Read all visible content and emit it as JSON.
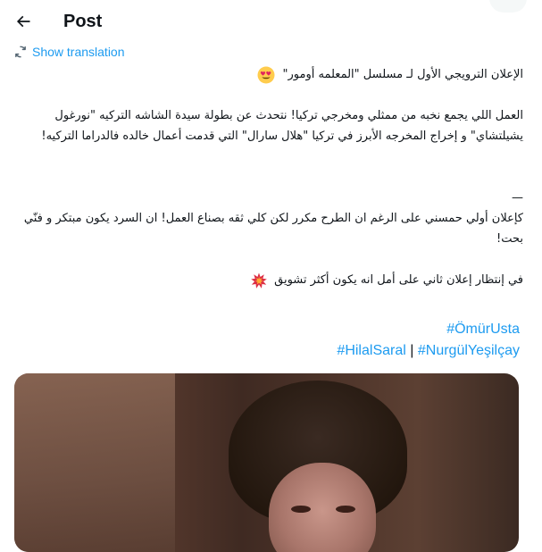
{
  "header": {
    "title": "Post",
    "back_icon": "arrow-left-icon"
  },
  "translation": {
    "label": "Show translation",
    "icon": "translate-icon"
  },
  "tweet": {
    "line1": "الإعلان الترويجي الأول لـ مسلسل \"المعلمه أومور\"",
    "line1_emoji": "smiling-face-with-heart-eyes",
    "paragraph2": "العمل اللي يجمع نخبه من ممثلي ومخرجي تركيا! نتحدث عن بطولة سيدة الشاشه التركيه \"نورغول يشيلتشاي\" و إخراج المخرجه الأبرز في تركيا \"هلال سارال\" التي قدمت أعمال خالده فالدراما التركيه!",
    "divider": "—",
    "paragraph3": "كإعلان أولي حمسني على الرغم ان الطرح مكرر لكن كلي ثقه بصناع العمل! ان السرد يكون مبتكر و فنّي بحت!",
    "line4": "في إنتظار إعلان ثاني على أمل انه يكون أكثر تشويق",
    "line4_emoji": "collision"
  },
  "hashtags": {
    "line1": [
      "#ÖmürUsta"
    ],
    "line2": [
      "#HilalSaral",
      "#NurgülYeşilçay"
    ],
    "separator": "|"
  },
  "colors": {
    "accent": "#1d9bf0",
    "text": "#0f1419",
    "background": "#ffffff"
  }
}
